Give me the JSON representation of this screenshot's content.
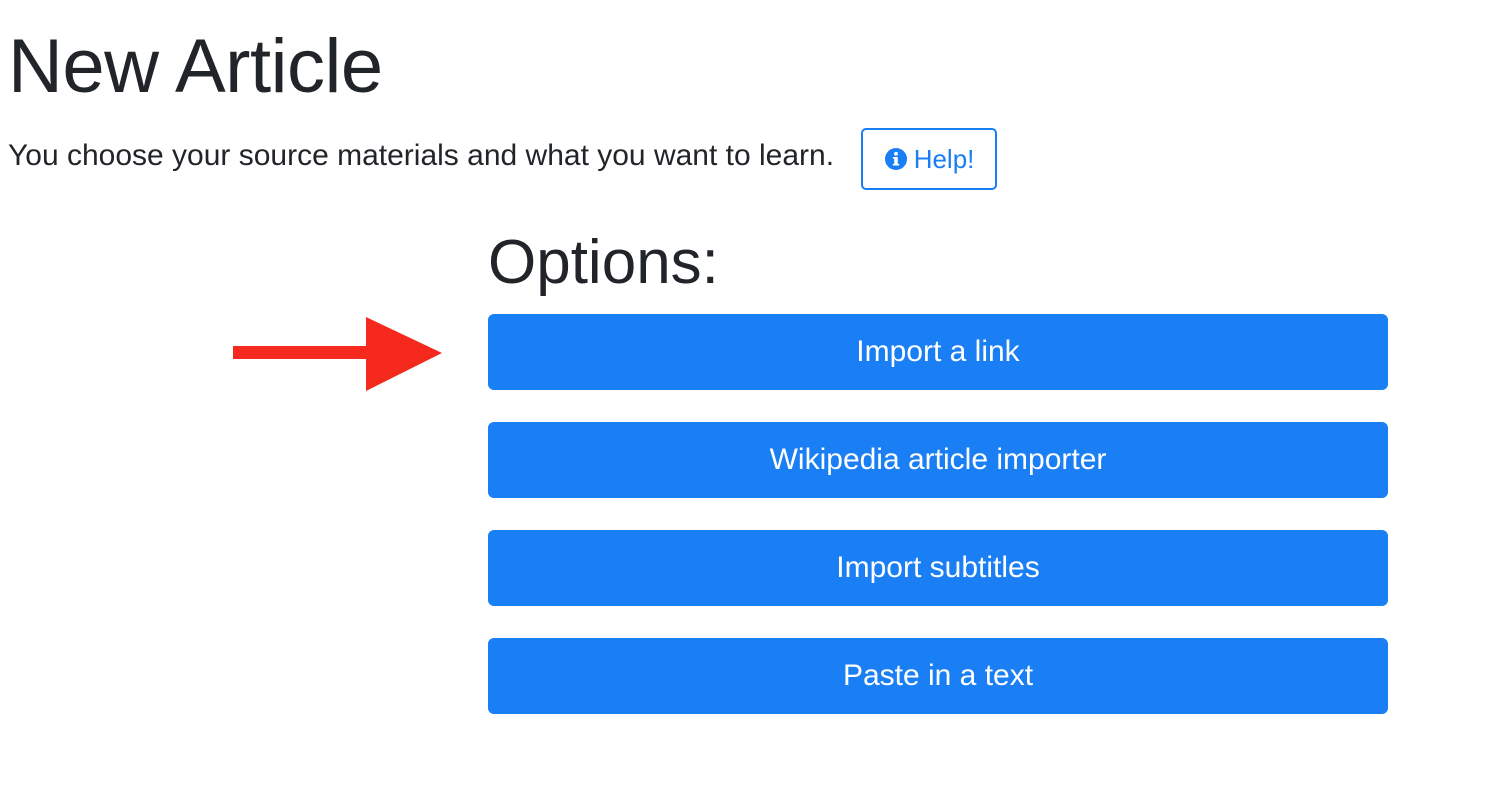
{
  "page": {
    "title": "New Article",
    "subtitle": "You choose your source materials and what you want to learn."
  },
  "help": {
    "label": "Help!",
    "icon": "info-circle-icon"
  },
  "options": {
    "heading": "Options:",
    "items": [
      {
        "label": "Import a link"
      },
      {
        "label": "Wikipedia article importer"
      },
      {
        "label": "Import subtitles"
      },
      {
        "label": "Paste in a text"
      }
    ]
  },
  "annotation": {
    "icon": "red-arrow-icon",
    "color": "#f5291d"
  },
  "colors": {
    "primary": "#1a7ff5",
    "text": "#212529"
  }
}
